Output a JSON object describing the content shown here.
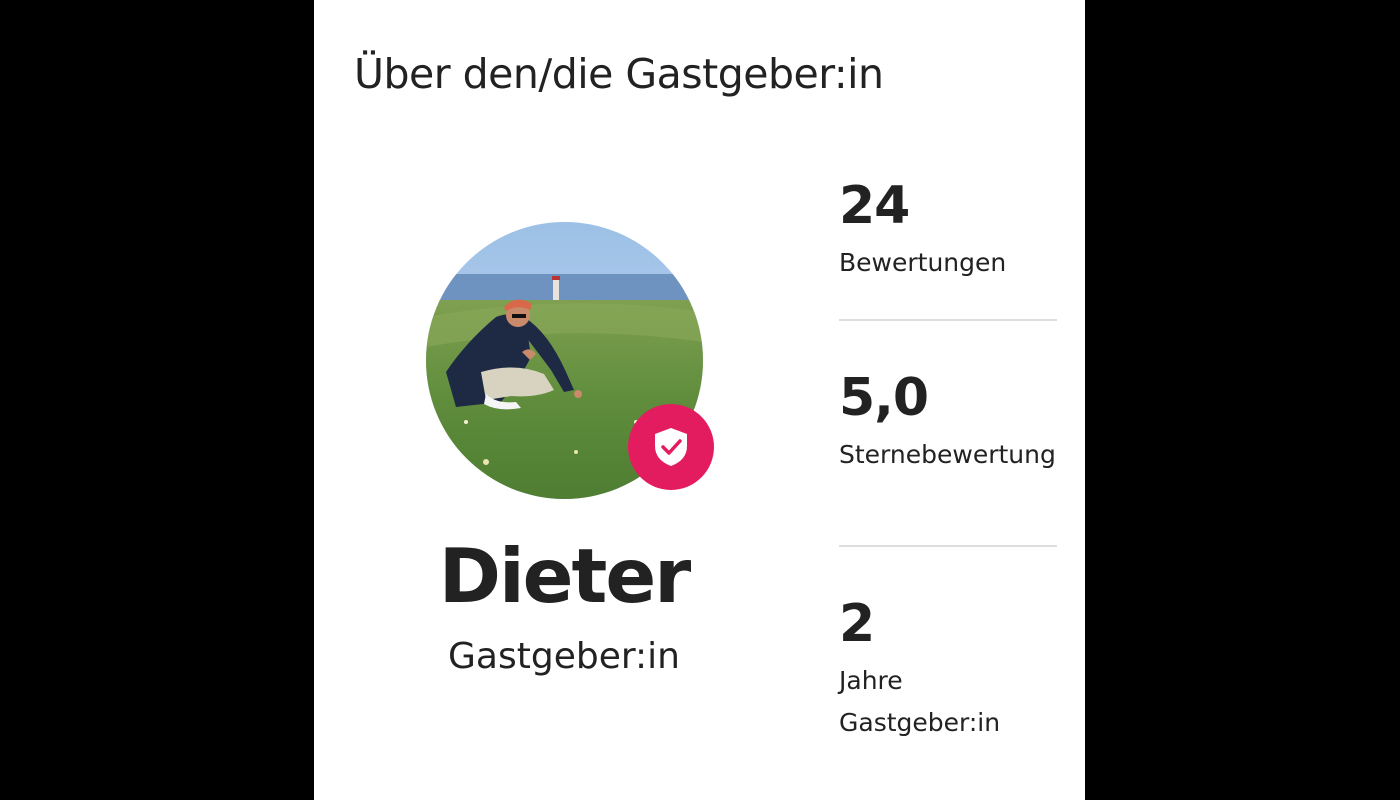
{
  "section": {
    "title": "Über den/die Gastgeber:in"
  },
  "host": {
    "name": "Dieter",
    "role": "Gastgeber:in",
    "verified_badge_icon": "shield-check-icon",
    "badge_color": "#e31c5f"
  },
  "stats": [
    {
      "value": "24",
      "label": "Bewertungen"
    },
    {
      "value": "5,0",
      "label": "Sternebewertung"
    },
    {
      "value": "2",
      "label": "Jahre Gastgeber:in"
    }
  ],
  "colors": {
    "background": "#000000",
    "card": "#ffffff",
    "text": "#222222",
    "divider": "#dddddd",
    "accent": "#e31c5f"
  }
}
